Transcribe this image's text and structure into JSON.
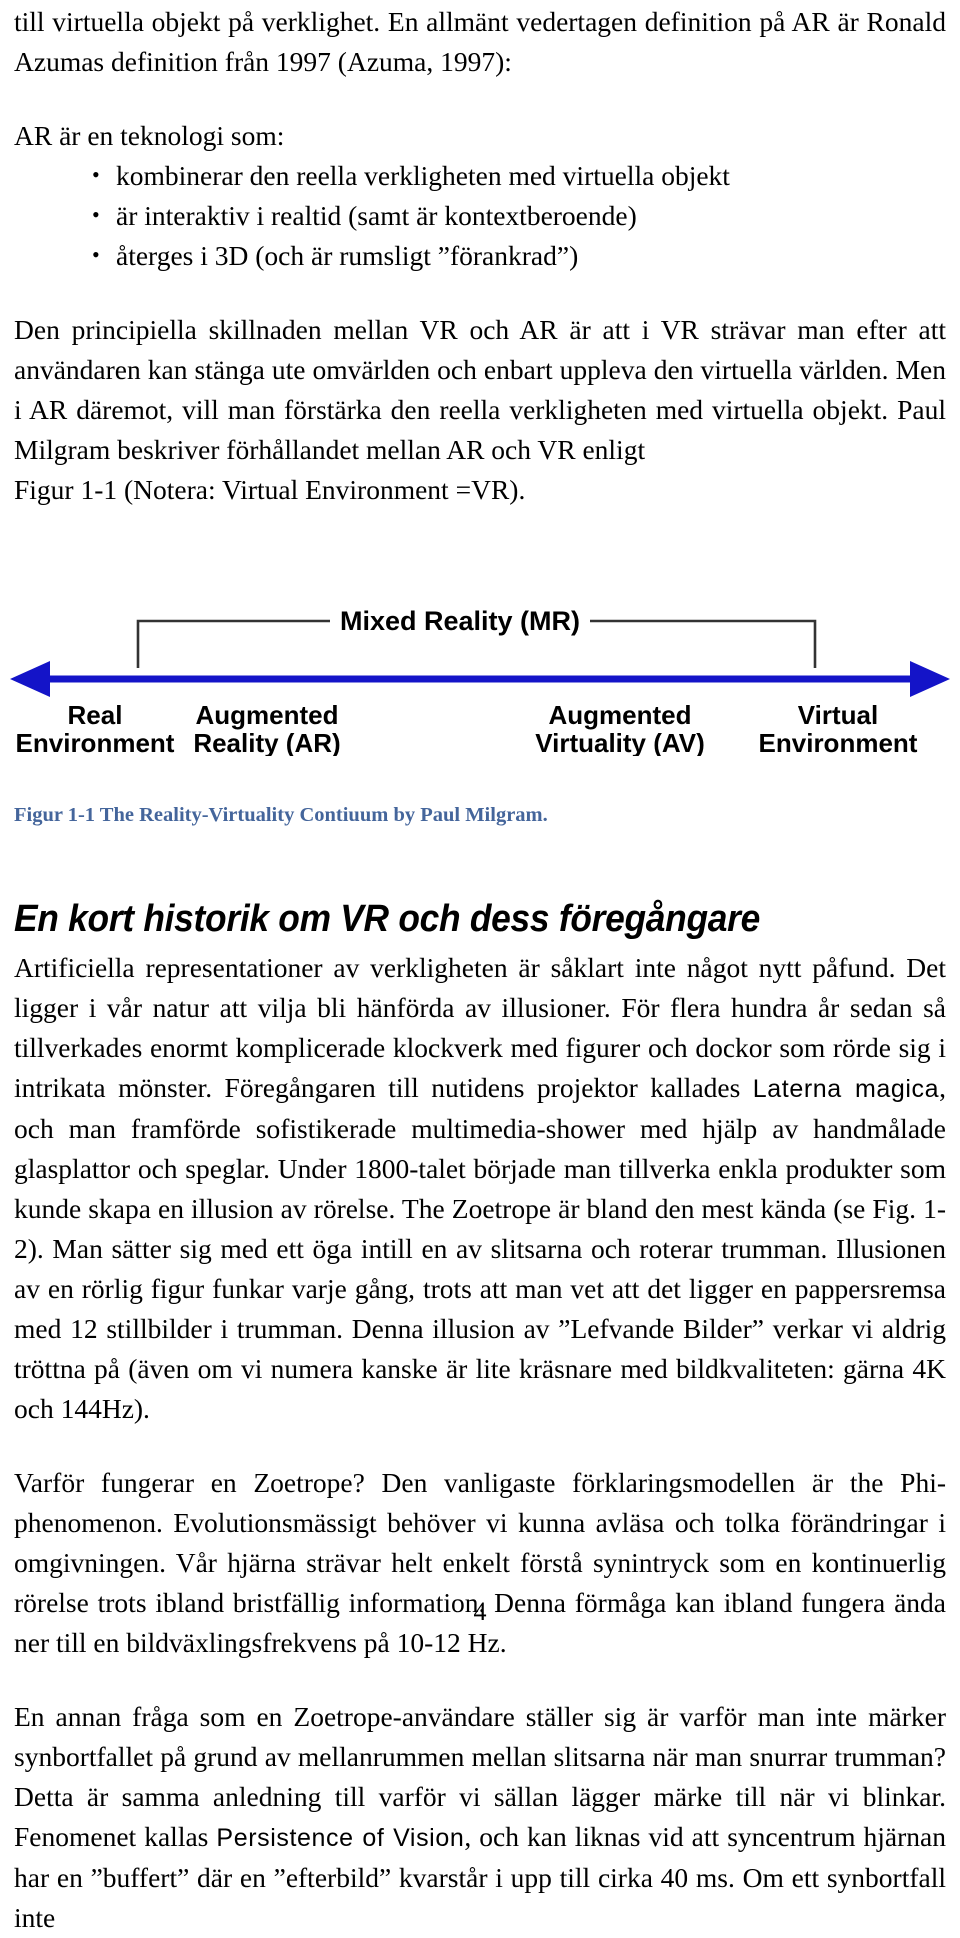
{
  "document": {
    "language": "sv",
    "page_number": "4"
  },
  "paragraphs": {
    "continued_top": "till virtuella objekt på verklighet. En allmänt vedertagen definition på AR är Ronald Azumas definition från 1997 (Azuma, 1997):",
    "ar_intro": "AR är en teknologi som:",
    "ar_bullets": [
      "kombinerar den reella verkligheten med virtuella objekt",
      "är interaktiv i realtid (samt är kontextberoende)",
      "återges i 3D (och är rumsligt ”förankrad”)"
    ],
    "vr_ar_difference": "Den principiella skillnaden mellan VR och AR är att i VR strävar man efter att användaren kan stänga ute omvärlden och enbart uppleva den virtuella världen. Men i AR däremot, vill man förstärka den reella verkligheten med virtuella objekt. Paul Milgram beskriver förhållandet mellan AR och VR enligt",
    "figure_reference": "Figur 1-1 (Notera: Virtual Environment =VR).",
    "history_p1_part1": "Artificiella representationer av verkligheten är såklart inte något nytt påfund. Det ligger i vår natur att vilja bli hänförda av illusioner. För flera hundra år sedan så tillverkades enormt komplicerade klockverk med figurer och dockor som rörde sig i intrikata mönster. Föregångaren till nutidens projektor kallades ",
    "history_p1_term": "Laterna magica",
    "history_p1_part2": ", och man framförde sofistikerade multimedia-shower med hjälp av handmålade glasplattor och speglar. Under 1800-talet började man tillverka enkla produkter som kunde skapa en illusion av rörelse. The Zoetrope är bland den mest kända (se Fig. 1-2). Man sätter sig med ett öga intill en av slitsarna och roterar trumman. Illusionen av en rörlig figur funkar varje gång, trots att man vet att det ligger en pappersremsa med 12 stillbilder i trumman. Denna illusion av ”Lefvande Bilder” verkar vi aldrig tröttna på (även om vi numera kanske är lite kräsnare med bildkvaliteten: gärna 4K och 144Hz).",
    "phi_paragraph": "Varför fungerar en Zoetrope? Den vanligaste förklaringsmodellen är the Phi-phenomenon. Evolutionsmässigt behöver vi kunna avläsa och tolka förändringar i omgivningen. Vår hjärna strävar helt enkelt förstå synintryck som en kontinuerlig rörelse trots ibland bristfällig information. Denna förmåga kan ibland fungera ända ner till en bildväxlingsfrekvens på 10-12 Hz.",
    "pov_part1": "En annan fråga som en Zoetrope-användare ställer sig är varför man inte märker synbortfallet på grund av mellanrummen mellan slitsarna när man snurrar trumman? Detta är samma anledning till varför vi sällan lägger märke till när vi blinkar. Fenomenet kallas ",
    "pov_term": "Persistence of Vision",
    "pov_part2": ", och kan liknas vid att syncentrum hjärnan har en ”buffert” där en ”efterbild” kvarstår i upp till cirka 40 ms. Om ett synbortfall inte"
  },
  "headings": {
    "history_section": "En kort historik om VR och dess föregångare"
  },
  "figure": {
    "caption": "Figur 1-1 The Reality-Virtuality Contiuum by Paul Milgram.",
    "bracket_label": "Mixed Reality (MR)",
    "axis_color": "#1414c8",
    "bracket_color": "#333333",
    "endpoints": [
      {
        "line1": "Real",
        "line2": "Environment"
      },
      {
        "line1": "Augmented",
        "line2": "Reality (AR)"
      },
      {
        "line1": "Augmented",
        "line2": "Virtuality (AV)"
      },
      {
        "line1": "Virtual",
        "line2": "Environment"
      }
    ]
  },
  "colors": {
    "caption": "#44659b",
    "axis": "#1414c8",
    "text": "#000000",
    "page_background": "#ffffff"
  }
}
